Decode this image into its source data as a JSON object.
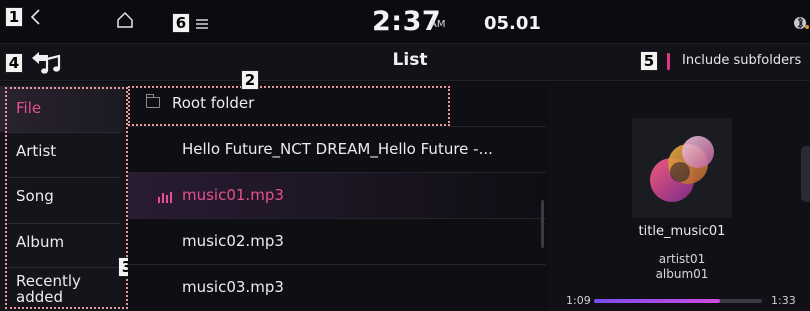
{
  "status_bar": {
    "time": "2:37",
    "am_pm": "AM",
    "date": "05.01",
    "icons": [
      "back-chevron-icon",
      "home-icon",
      "menu-icon",
      "bluetooth-icon"
    ]
  },
  "header": {
    "back_icon": "music-back-icon",
    "title": "List",
    "subfolders_label": "Include subfolders"
  },
  "callouts": [
    "1",
    "2",
    "3",
    "4",
    "5",
    "6"
  ],
  "categories": [
    {
      "label": "File",
      "active": true
    },
    {
      "label": "Artist",
      "active": false
    },
    {
      "label": "Song",
      "active": false
    },
    {
      "label": "Album",
      "active": false
    },
    {
      "label": "Recently\nadded",
      "active": false
    }
  ],
  "root_folder": {
    "label": "Root folder",
    "icon": "folder-icon"
  },
  "files": [
    {
      "label": "Hello Future_NCT DREAM_Hello Future -...",
      "active": false
    },
    {
      "label": "music01.mp3",
      "active": true
    },
    {
      "label": "music02.mp3",
      "active": false
    },
    {
      "label": "music03.mp3",
      "active": false
    }
  ],
  "now_playing": {
    "title": "title_music01",
    "artist": "artist01",
    "album": "album01",
    "elapsed": "1:09",
    "total": "1:33",
    "progress": 0.75
  },
  "colors": {
    "accent": "#e6508e",
    "background": "#0b0b10",
    "progress_start": "#7a4cf0",
    "progress_end": "#d04ce0"
  }
}
